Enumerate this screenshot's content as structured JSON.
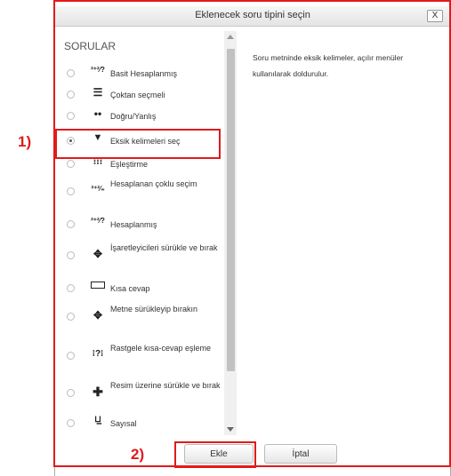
{
  "dialog": {
    "title": "Eklenecek soru tipini seçin",
    "close_label": "X",
    "section_label": "SORULAR",
    "description": "Soru metninde eksik kelimeler, açılır menüler kullanılarak doldurulur.",
    "items": [
      {
        "label": "Basit Hesaplanmış",
        "icon": "2+2/?",
        "selected": false
      },
      {
        "label": "Çoktan seçmeli",
        "icon": "list-icon",
        "selected": false
      },
      {
        "label": "Doğru/Yanlış",
        "icon": "dots-icon",
        "selected": false
      },
      {
        "label": "Eksik kelimeleri seç",
        "icon": "dropdown-arrow-icon",
        "selected": true
      },
      {
        "label": "Eşleştirme",
        "icon": "matching-icon",
        "selected": false
      },
      {
        "label": "Hesaplanan çoklu seçim",
        "icon": "2+2/?",
        "selected": false
      },
      {
        "label": "Hesaplanmış",
        "icon": "2+2/?",
        "selected": false
      },
      {
        "label": "İşaretleyicileri sürükle ve bırak",
        "icon": "move-marker-icon",
        "selected": false
      },
      {
        "label": "Kısa cevap",
        "icon": "textbox-icon",
        "selected": false
      },
      {
        "label": "Metne sürükleyip bırakın",
        "icon": "move-text-icon",
        "selected": false
      },
      {
        "label": "Rastgele kısa-cevap eşleme",
        "icon": "random-match-icon",
        "selected": false
      },
      {
        "label": "Resim üzerine sürükle ve bırak",
        "icon": "move-image-icon",
        "selected": false
      },
      {
        "label": "Sayısal",
        "icon": "numeric-icon",
        "selected": false
      }
    ],
    "add_button": "Ekle",
    "cancel_button": "İptal"
  },
  "annotations": {
    "marker1": "1)",
    "marker2": "2)",
    "highlight_color": "#e01b1b"
  }
}
